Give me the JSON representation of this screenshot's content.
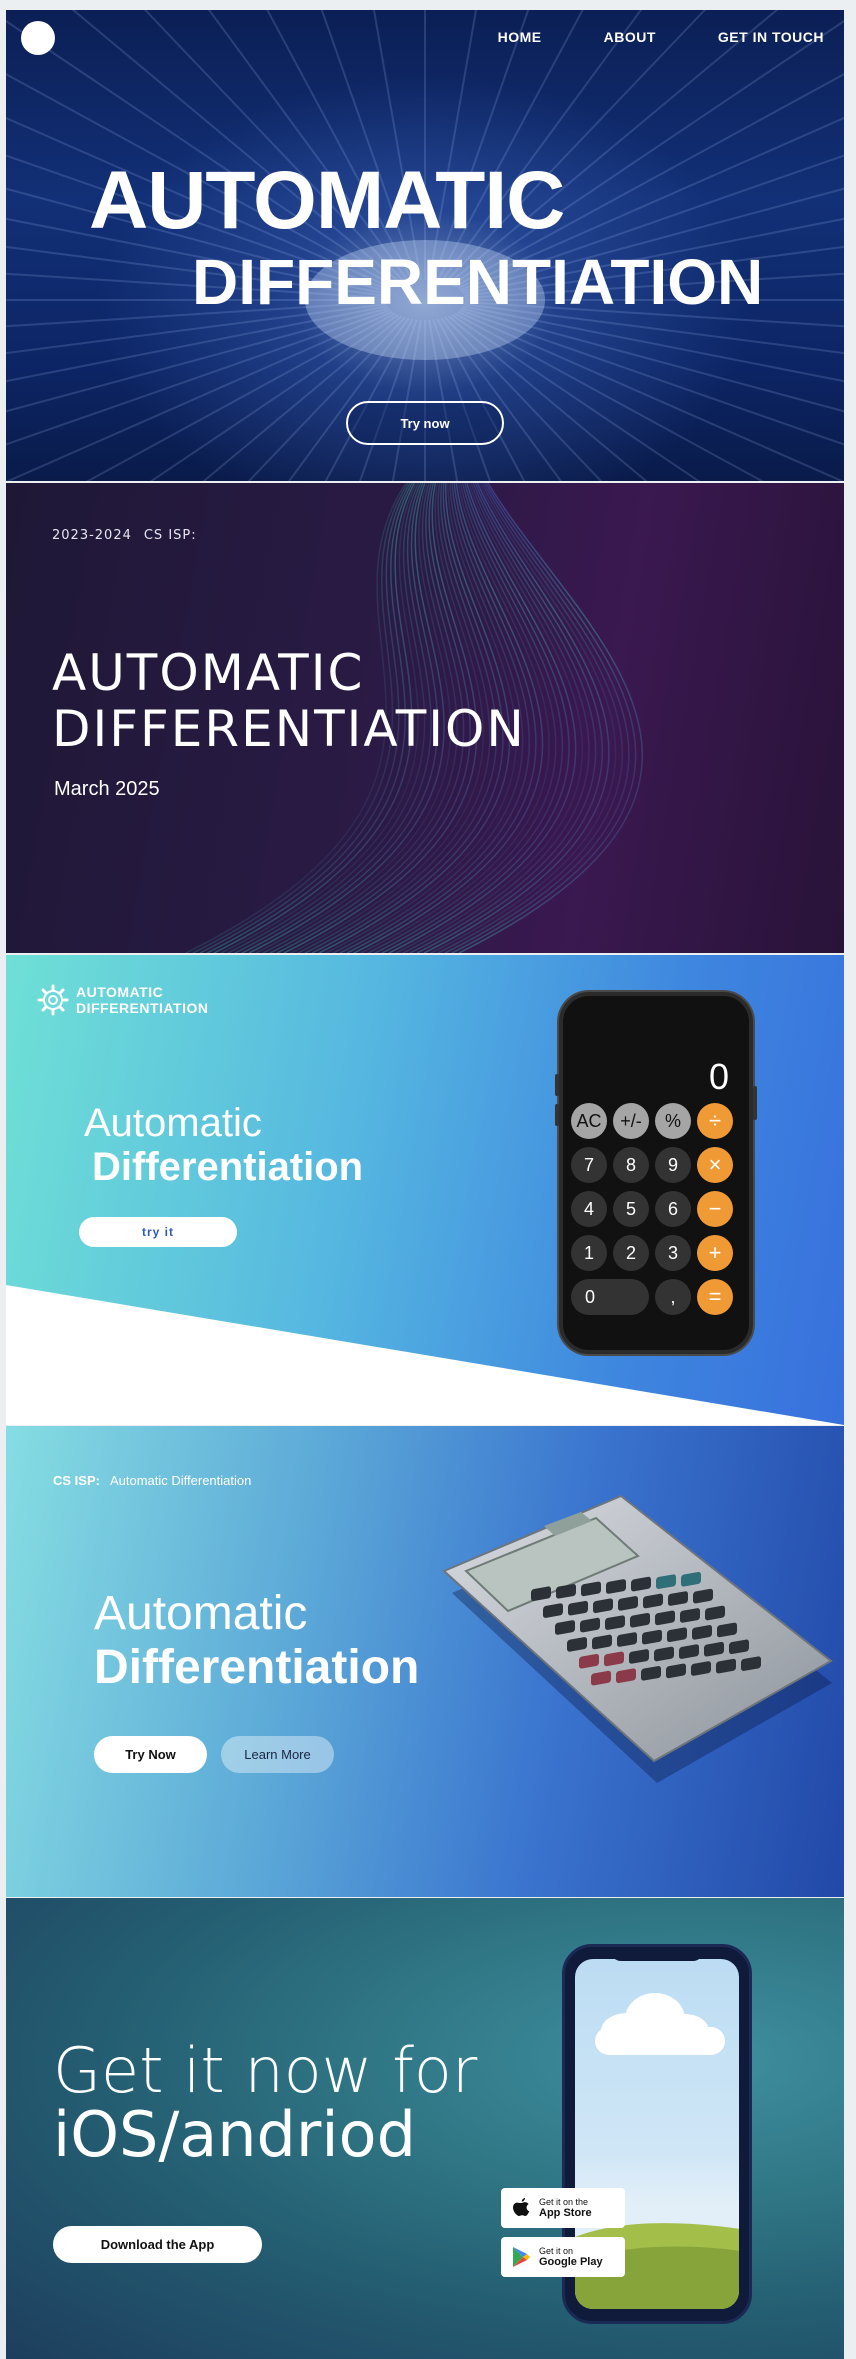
{
  "hero": {
    "nav": [
      "HOME",
      "ABOUT",
      "GET IN TOUCH"
    ],
    "title_line1": "AUTOMATIC",
    "title_line2": "DIFFERENTIATION",
    "cta": "Try now"
  },
  "cover": {
    "year": "2023-2024",
    "course": "CS ISP:",
    "title_line1": "AUTOMATIC",
    "title_line2": "DIFFERENTIATION",
    "date": "March 2025"
  },
  "calculator_section": {
    "brand_line1": "AUTOMATIC",
    "brand_line2": "DIFFERENTIATION",
    "title_line1": "Automatic",
    "title_line2": "Differentiation",
    "cta": "try it",
    "phone": {
      "display": "0",
      "keys": [
        "AC",
        "+/-",
        "%",
        "÷",
        "7",
        "8",
        "9",
        "×",
        "4",
        "5",
        "6",
        "−",
        "1",
        "2",
        "3",
        "+",
        "0",
        ",",
        "="
      ]
    }
  },
  "product_section": {
    "crumb_bold": "CS ISP:",
    "crumb_text": "Automatic Differentiation",
    "title_line1": "Automatic",
    "title_line2": "Differentiation",
    "primary_cta": "Try Now",
    "secondary_cta": "Learn More"
  },
  "download_section": {
    "title_line1": "Get it now for",
    "title_line2": "iOS/andriod",
    "cta": "Download the App",
    "app_store_small": "Get it on the",
    "app_store_big": "App Store",
    "play_small": "Get it on",
    "play_big": "Google Play"
  },
  "colors": {
    "accent_orange": "#f09a36",
    "hero_blue": "#123077",
    "cover_purple": "#2a1a45",
    "teal": "#6fe0d6"
  }
}
